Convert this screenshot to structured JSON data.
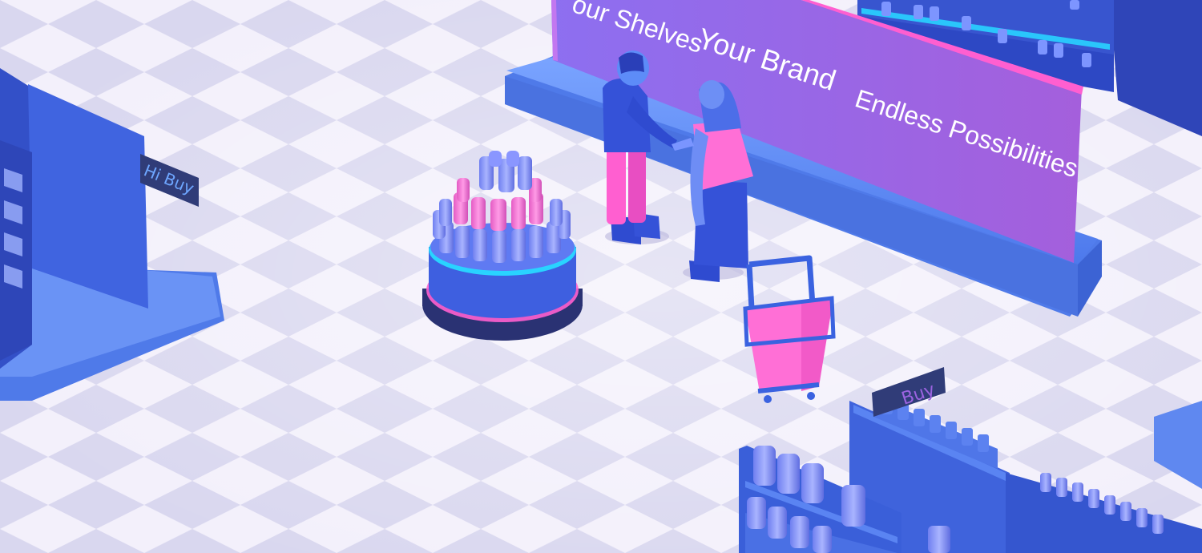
{
  "billboard": {
    "line1": "our Shelves",
    "line2": "Your Brand",
    "line3": "Endless Possibilities"
  },
  "signs": {
    "left_sign": "Hi Buy",
    "right_sign": "Buy"
  },
  "colors": {
    "floor_light": "#f4f1fb",
    "floor_dark": "#d8d6ee",
    "shelf_blue": "#3f6fe6",
    "accent_pink": "#ff5fd0",
    "billboard_purple": "#9b63e0",
    "neon_cyan": "#29d3ff"
  }
}
